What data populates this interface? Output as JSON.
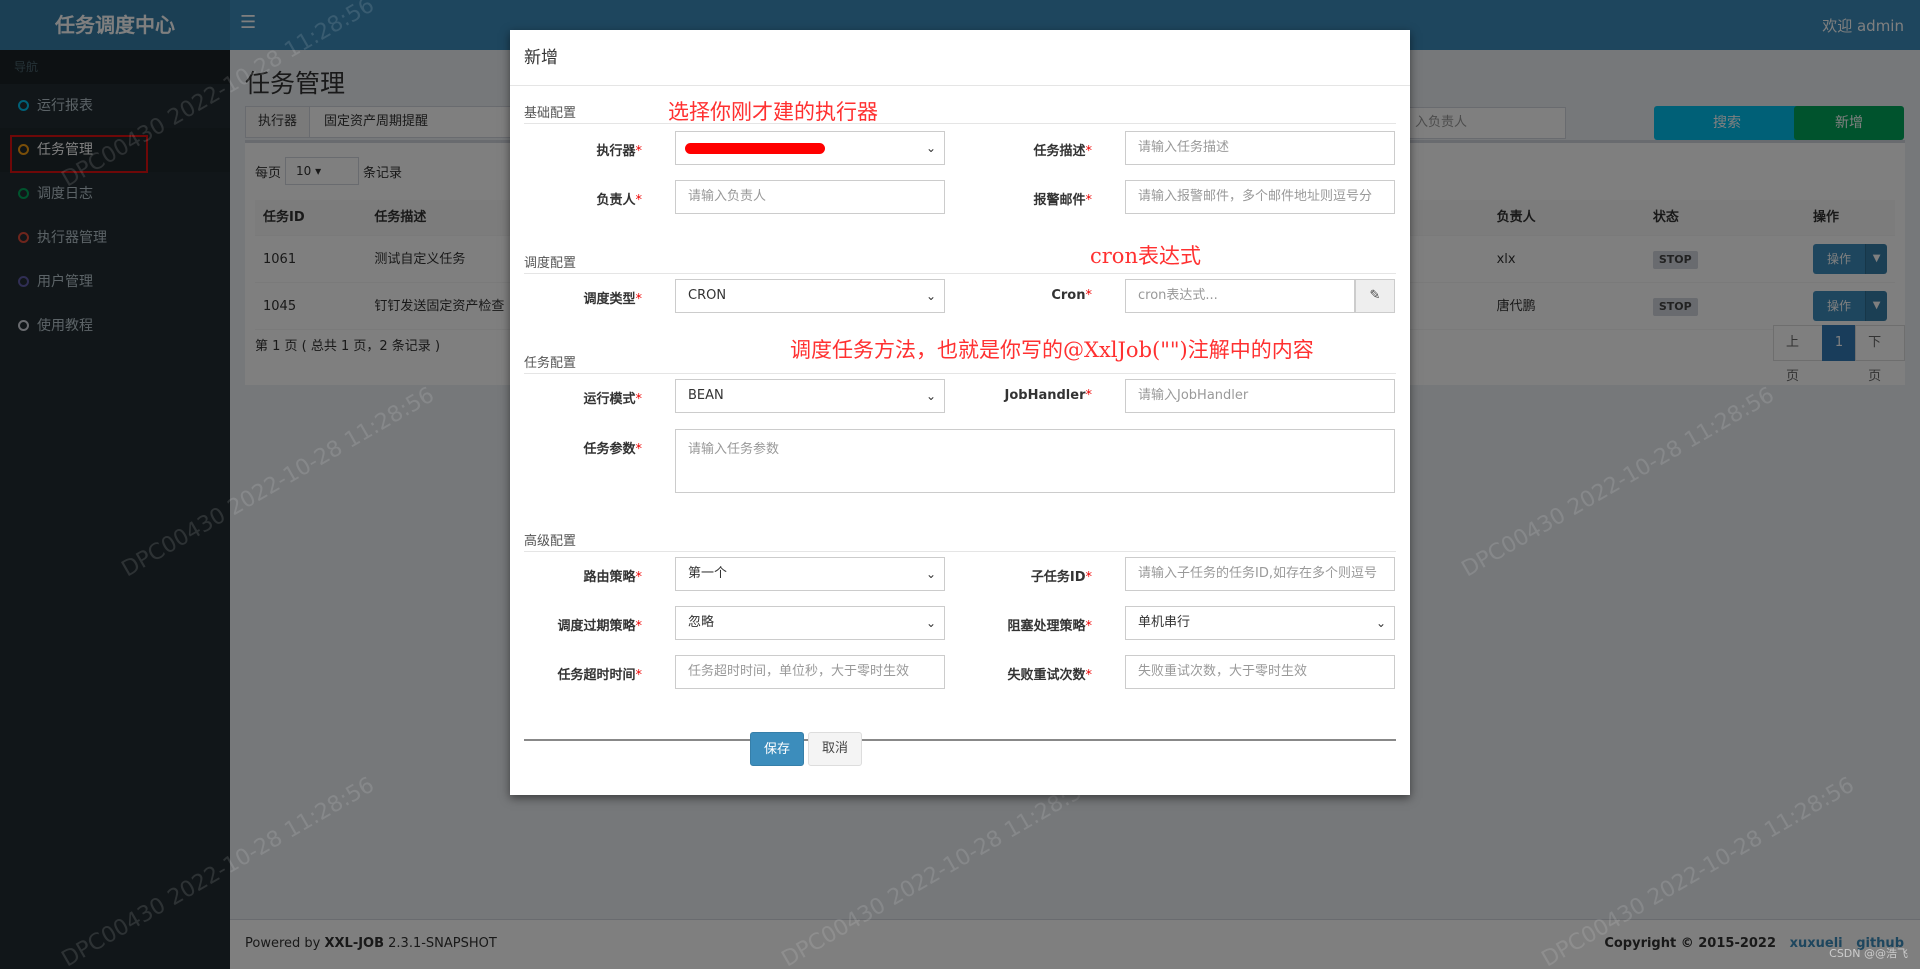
{
  "header": {
    "logo": "任务调度中心",
    "menu_icon": "hamburger-icon",
    "welcome": "欢迎 admin"
  },
  "sidebar": {
    "header": "导航",
    "items": [
      {
        "label": "运行报表",
        "color": "#00c0ef"
      },
      {
        "label": "任务管理",
        "color": "#f39c12"
      },
      {
        "label": "调度日志",
        "color": "#00a65a"
      },
      {
        "label": "执行器管理",
        "color": "#dd4b39"
      },
      {
        "label": "用户管理",
        "color": "#605ca8"
      },
      {
        "label": "使用教程",
        "color": "#d2d6de"
      }
    ]
  },
  "page": {
    "title": "任务管理",
    "filter_label": "执行器",
    "filter_value": "固定资产周期提醒",
    "author_placeholder": "入负责人",
    "search_label": "搜索",
    "add_label": "新增"
  },
  "table": {
    "per_page_label": "每页",
    "per_page_value": "10",
    "records_label": "条记录",
    "headers": [
      "任务ID",
      "任务描述",
      "负责人",
      "状态",
      "操作"
    ],
    "rows": [
      {
        "id": "1061",
        "desc": "测试自定义任务",
        "author": "xlx",
        "status": "STOP",
        "op": "操作"
      },
      {
        "id": "1045",
        "desc": "钉钉发送固定资产检查",
        "author": "唐代鹏",
        "status": "STOP",
        "op": "操作"
      }
    ],
    "summary": "第 1 页 ( 总共 1 页，2 条记录 )",
    "pager": {
      "prev": "上页",
      "current": "1",
      "next": "下页"
    }
  },
  "footer": {
    "powered_prefix": "Powered by ",
    "product": "XXL-JOB",
    "version": " 2.3.1-SNAPSHOT",
    "copyright": "Copyright © 2015-2022",
    "link1": "xuxueli",
    "link2": "github"
  },
  "watermark": "DPC00430  2022-10-28 11:28:56",
  "csdn": "CSDN @@浩飞",
  "modal": {
    "title": "新增",
    "sections": {
      "basic": "基础配置",
      "schedule": "调度配置",
      "task": "任务配置",
      "advanced": "高级配置"
    },
    "fields": {
      "executor": {
        "label": "执行器",
        "value": ""
      },
      "job_desc": {
        "label": "任务描述",
        "placeholder": "请输入任务描述"
      },
      "author": {
        "label": "负责人",
        "placeholder": "请输入负责人"
      },
      "alarm_email": {
        "label": "报警邮件",
        "placeholder": "请输入报警邮件，多个邮件地址则逗号分"
      },
      "schedule_type": {
        "label": "调度类型",
        "value": "CRON"
      },
      "cron": {
        "label": "Cron",
        "placeholder": "cron表达式..."
      },
      "run_mode": {
        "label": "运行模式",
        "value": "BEAN"
      },
      "job_handler": {
        "label": "JobHandler",
        "placeholder": "请输入JobHandler"
      },
      "job_param": {
        "label": "任务参数",
        "placeholder": "请输入任务参数"
      },
      "route": {
        "label": "路由策略",
        "value": "第一个"
      },
      "child_job": {
        "label": "子任务ID",
        "placeholder": "请输入子任务的任务ID,如存在多个则逗号"
      },
      "misfire": {
        "label": "调度过期策略",
        "value": "忽略"
      },
      "block": {
        "label": "阻塞处理策略",
        "value": "单机串行"
      },
      "timeout": {
        "label": "任务超时时间",
        "placeholder": "任务超时时间，单位秒，大于零时生效"
      },
      "retry": {
        "label": "失败重试次数",
        "placeholder": "失败重试次数，大于零时生效"
      }
    },
    "save_label": "保存",
    "cancel_label": "取消",
    "annotations": {
      "executor": "选择你刚才建的执行器",
      "cron": "cron表达式",
      "handler": "调度任务方法，也就是你写的@XxlJob(\"\")注解中的内容"
    }
  }
}
